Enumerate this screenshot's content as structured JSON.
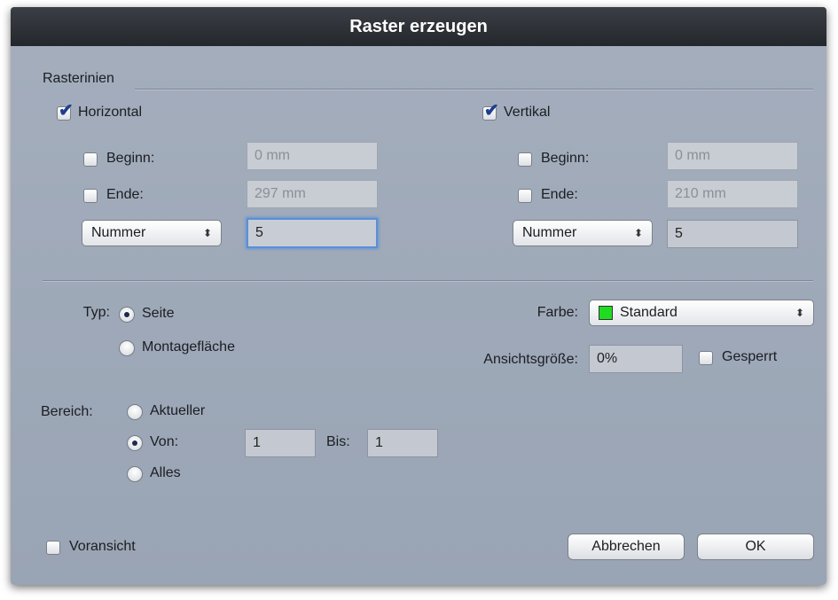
{
  "dialog": {
    "title": "Raster erzeugen"
  },
  "gridlines": {
    "section_label": "Rasterinien",
    "horizontal": {
      "label": "Horizontal",
      "checked": true,
      "begin_label": "Beginn:",
      "begin_value": "0 mm",
      "end_label": "Ende:",
      "end_value": "297 mm",
      "mode_select": "Nummer",
      "count_value": "5"
    },
    "vertical": {
      "label": "Vertikal",
      "checked": true,
      "begin_label": "Beginn:",
      "begin_value": "0 mm",
      "end_label": "Ende:",
      "end_value": "210 mm",
      "mode_select": "Nummer",
      "count_value": "5"
    }
  },
  "type": {
    "label": "Typ:",
    "options": [
      "Seite",
      "Montagefläche"
    ],
    "selected": "Seite"
  },
  "color": {
    "label": "Farbe:",
    "value": "Standard",
    "swatch_color": "#20dc20"
  },
  "view_size": {
    "label": "Ansichtsgröße:",
    "value": "0%",
    "locked_label": "Gesperrt"
  },
  "range": {
    "label": "Bereich:",
    "options": [
      "Aktueller",
      "Von:",
      "Alles"
    ],
    "selected": "Von:",
    "from_value": "1",
    "to_label": "Bis:",
    "to_value": "1"
  },
  "footer": {
    "preview_label": "Voransicht",
    "cancel_label": "Abbrechen",
    "ok_label": "OK"
  },
  "colors": {
    "dialog_bg": "#a4aebd",
    "titlebar_bg": "#2f3237",
    "focus_ring": "#5a8fd8",
    "check_blue": "#1d3e8c"
  },
  "icons": {
    "checkmark": "check-icon",
    "popup_arrows": "updown-arrows-icon",
    "radio_selected": "radio-dot-icon"
  }
}
